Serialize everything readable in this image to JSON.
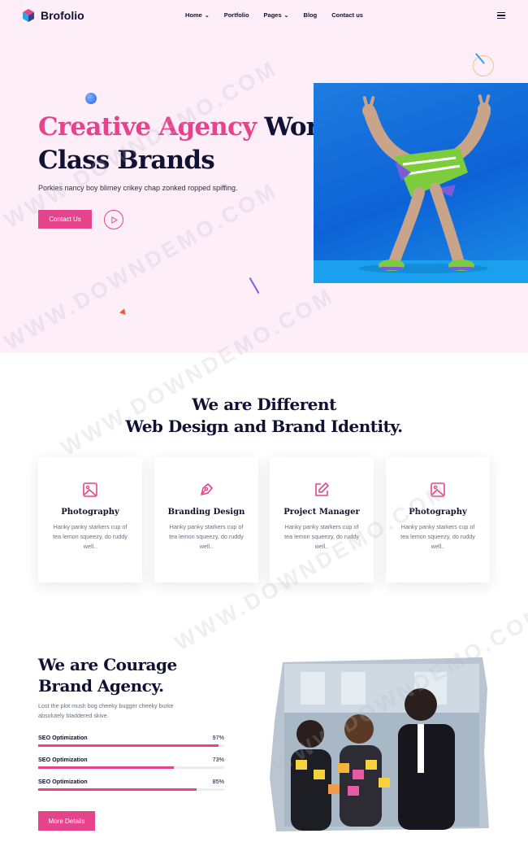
{
  "brand": {
    "name": "Brofolio"
  },
  "nav": {
    "items": [
      {
        "label": "Home",
        "has_dropdown": true
      },
      {
        "label": "Portfolio",
        "has_dropdown": false
      },
      {
        "label": "Pages",
        "has_dropdown": true
      },
      {
        "label": "Blog",
        "has_dropdown": false
      },
      {
        "label": "Contact us",
        "has_dropdown": false
      }
    ],
    "menu_icon": "hamburger-icon"
  },
  "hero": {
    "title_highlight": "Creative Agency",
    "title_rest_line1": "World",
    "title_line2": "Class Brands",
    "subtitle": "Porkies nancy boy blimey crikey chap zonked ropped spiffing.",
    "cta_label": "Contact Us",
    "play_icon": "play-icon"
  },
  "services": {
    "title_line1": "We are Different",
    "title_line2": "Web Design and Brand Identity.",
    "cards": [
      {
        "icon": "image-icon",
        "title": "Photography",
        "desc": "Hanky panky starkers cup of tea lemon squeezy, do ruddy well.."
      },
      {
        "icon": "pen-tool-icon",
        "title": "Branding Design",
        "desc": "Hanky panky starkers cup of tea lemon squeezy, do ruddy well.."
      },
      {
        "icon": "edit-icon",
        "title": "Project Manager",
        "desc": "Hanky panky starkers cup of tea lemon squeezy, do ruddy well.."
      },
      {
        "icon": "image-icon",
        "title": "Photography",
        "desc": "Hanky panky starkers cup of tea lemon squeezy, do ruddy well.."
      }
    ]
  },
  "about": {
    "title_line1": "We are Courage",
    "title_line2": "Brand Agency.",
    "subtitle": "Lost the plot mush bog cheeky bugger cheeky burke absolutely bladdered skive.",
    "skills": [
      {
        "label": "SEO Optimization",
        "value": "97%",
        "fraction": 0.97
      },
      {
        "label": "SEO Optimization",
        "value": "73%",
        "fraction": 0.73
      },
      {
        "label": "SEO Optimization",
        "value": "85%",
        "fraction": 0.85
      }
    ],
    "cta_label": "More Details"
  },
  "watermark": "WWW.DOWNDEMO.COM",
  "colors": {
    "accent": "#e6438d",
    "dark": "#0f1232",
    "hero_bg": "#fdeef8"
  }
}
